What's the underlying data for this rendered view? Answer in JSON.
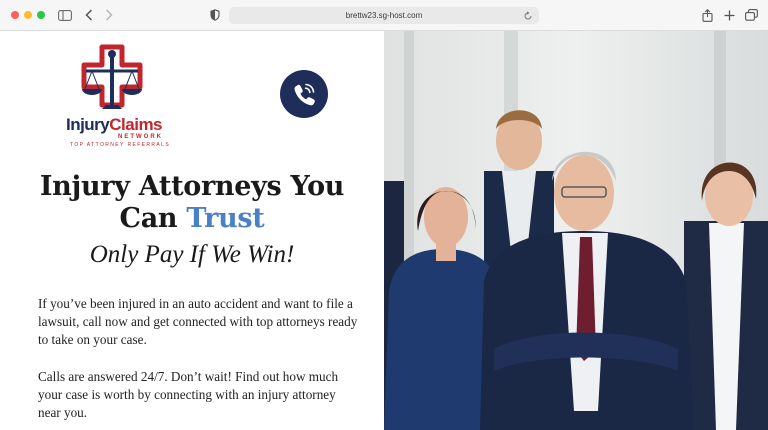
{
  "browser": {
    "url": "brettw23.sg-host.com",
    "icons": [
      "sidebar-icon",
      "back-icon",
      "forward-icon",
      "shield-icon",
      "reload-icon",
      "share-icon",
      "plus-icon",
      "tabs-icon"
    ]
  },
  "logo": {
    "title_part1": "Injury",
    "title_part2": "Claims",
    "network": "NETWORK",
    "tagline": "TOP ATTORNEY REFERRALS"
  },
  "phone": {
    "icon": "phone-icon"
  },
  "hero": {
    "headline_line1": "Injury Attorneys You",
    "headline_line2_start": "Can ",
    "headline_accent": "Trust",
    "subhead": "Only Pay If We Win!",
    "paragraph1": "If you’ve been injured in an auto accident and want to file a lawsuit, call now and get connected with top attorneys ready to take on your case.",
    "paragraph2": "Calls are answered 24/7. Don’t wait! Find out how much your case is worth by connecting with an injury attorney near you."
  },
  "colors": {
    "navy": "#1e2d5a",
    "brand_red": "#c0262d",
    "accent_blue": "#4a80c6"
  }
}
